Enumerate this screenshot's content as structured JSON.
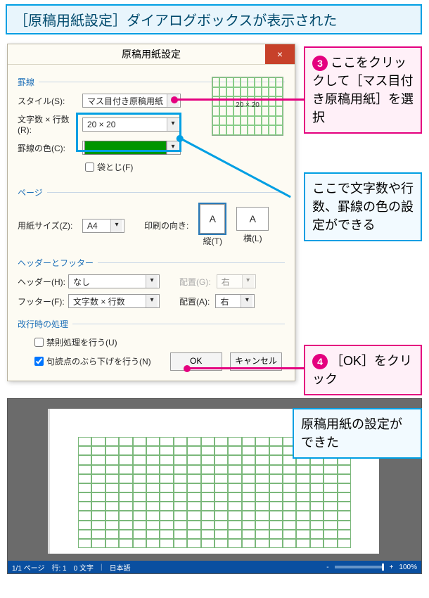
{
  "banner": "［原稿用紙設定］ダイアログボックスが表示された",
  "callout3": {
    "bullet": "3",
    "text": "ここをクリックして［マス目付き原稿用紙］を選択"
  },
  "callout_mid": "ここで文字数や行数、罫線の色の設定ができる",
  "callout4": {
    "bullet": "4",
    "text": "［OK］をクリック"
  },
  "callout_done": "原稿用紙の設定ができた",
  "dialog": {
    "title": "原稿用紙設定",
    "groups": {
      "grid": "罫線",
      "page": "ページ",
      "hf": "ヘッダーとフッター",
      "wrap": "改行時の処理"
    },
    "labels": {
      "style": "スタイル(S):",
      "cr": "文字数 × 行数(R):",
      "color": "罫線の色(C):",
      "fold": "袋とじ(F)",
      "papersize": "用紙サイズ(Z):",
      "orient": "印刷の向き:",
      "header": "ヘッダー(H):",
      "footer": "フッター(F):",
      "alignG": "配置(G):",
      "alignA": "配置(A):",
      "kinsoku": "禁則処理を行う(U)",
      "burasage": "句読点のぶら下げを行う(N)"
    },
    "values": {
      "style": "マス目付き原稿用紙",
      "cr": "20 × 20",
      "preview": "20 × 20",
      "paper": "A4",
      "orient_v": "縦(T)",
      "orient_h": "横(L)",
      "header": "なし",
      "footer": "文字数 × 行数",
      "alignG": "右",
      "alignA": "右"
    },
    "buttons": {
      "ok": "OK",
      "cancel": "キャンセル"
    }
  },
  "statusbar": {
    "page": "1/1 ページ",
    "line": "行: 1",
    "chars": "0 文字",
    "ime": "日本語",
    "zoom": "100%",
    "minus": "-",
    "plus": "+"
  }
}
